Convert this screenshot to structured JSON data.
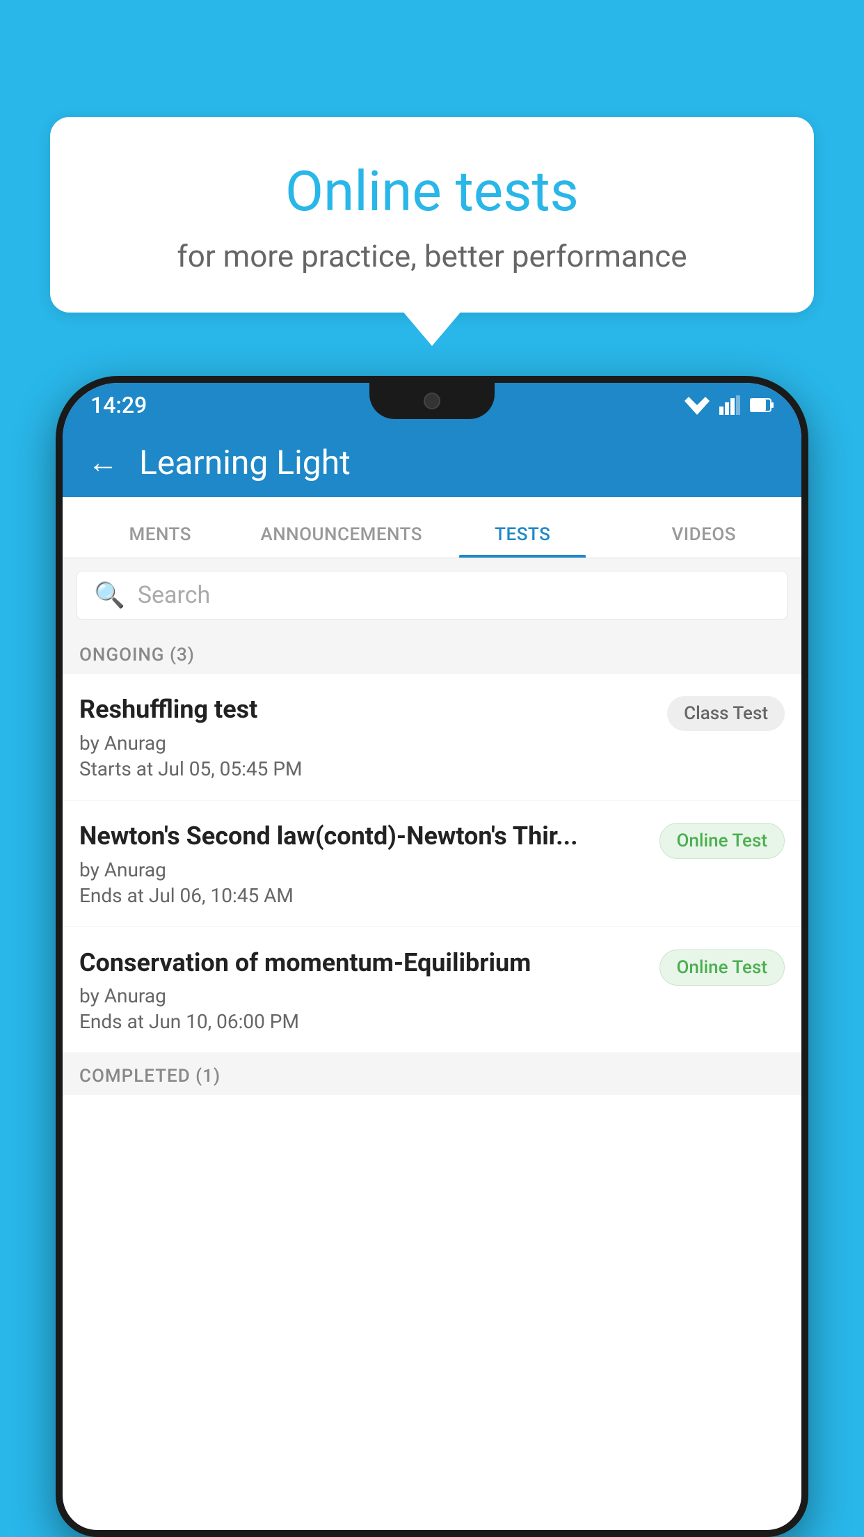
{
  "background": {
    "color": "#29b6e8"
  },
  "speech_bubble": {
    "title": "Online tests",
    "subtitle": "for more practice, better performance"
  },
  "status_bar": {
    "time": "14:29"
  },
  "app_bar": {
    "back_label": "←",
    "title": "Learning Light"
  },
  "tabs": [
    {
      "label": "MENTS",
      "active": false
    },
    {
      "label": "ANNOUNCEMENTS",
      "active": false
    },
    {
      "label": "TESTS",
      "active": true
    },
    {
      "label": "VIDEOS",
      "active": false
    }
  ],
  "search": {
    "placeholder": "Search"
  },
  "ongoing_section": {
    "header": "ONGOING (3)"
  },
  "tests": [
    {
      "name": "Reshuffling test",
      "by": "by Anurag",
      "time": "Starts at  Jul 05, 05:45 PM",
      "badge": "Class Test",
      "badge_type": "class"
    },
    {
      "name": "Newton's Second law(contd)-Newton's Thir...",
      "by": "by Anurag",
      "time": "Ends at  Jul 06, 10:45 AM",
      "badge": "Online Test",
      "badge_type": "online"
    },
    {
      "name": "Conservation of momentum-Equilibrium",
      "by": "by Anurag",
      "time": "Ends at  Jun 10, 06:00 PM",
      "badge": "Online Test",
      "badge_type": "online"
    }
  ],
  "completed_section": {
    "header": "COMPLETED (1)"
  }
}
